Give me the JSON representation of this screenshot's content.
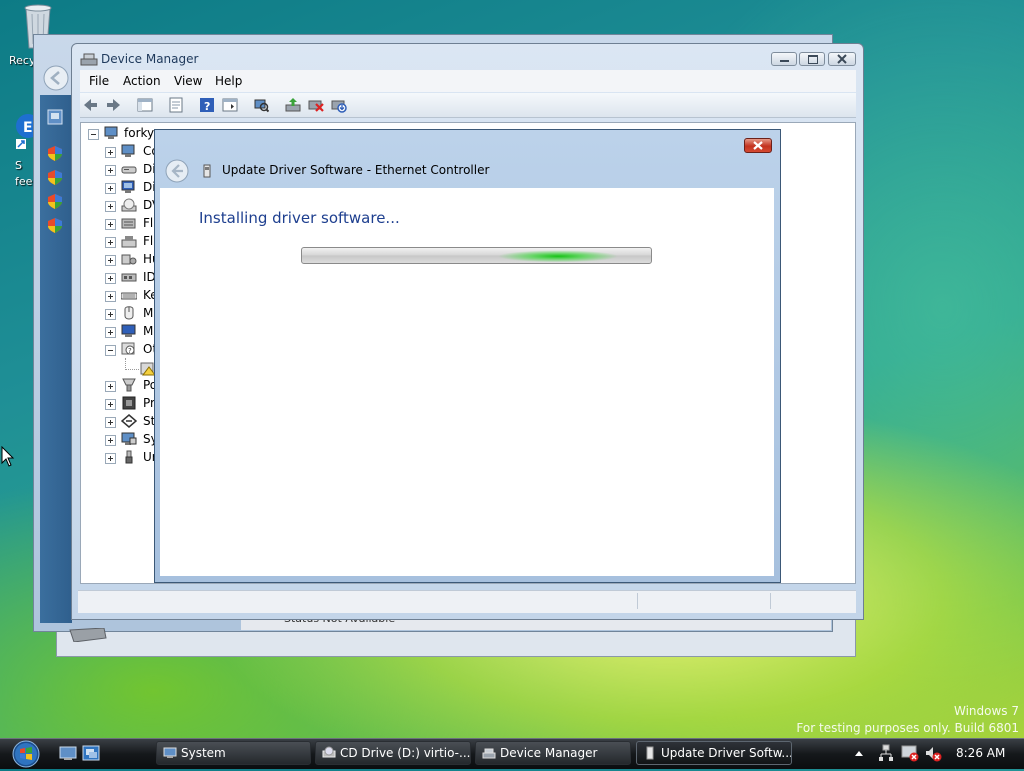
{
  "desktop": {
    "icons": [
      {
        "label": "Recy",
        "icon": "recycle-bin-icon"
      },
      {
        "label": "S\nfeed",
        "icon": "feedback-shortcut-icon"
      }
    ],
    "watermark": {
      "line1": "Windows 7",
      "line2": "For testing purposes only. Build 6801"
    }
  },
  "background_window": {
    "status_text": "Status Not Available"
  },
  "device_manager": {
    "title": "Device Manager",
    "menu": [
      "File",
      "Action",
      "View",
      "Help"
    ],
    "toolbar": [
      "back-icon",
      "forward-icon",
      "show-hide-tree-icon",
      "properties-icon",
      "help-icon",
      "view-icon",
      "scan-hardware-icon",
      "update-driver-icon",
      "uninstall-icon",
      "disable-icon"
    ],
    "tree": {
      "root": "forky-",
      "items": [
        {
          "label": "Co",
          "icon": "computer-icon",
          "expanded": false
        },
        {
          "label": "Di",
          "icon": "disk-drive-icon",
          "expanded": false
        },
        {
          "label": "Di",
          "icon": "display-adapter-icon",
          "expanded": false
        },
        {
          "label": "DV",
          "icon": "dvd-drive-icon",
          "expanded": false
        },
        {
          "label": "Fl",
          "icon": "floppy-controller-icon",
          "expanded": false
        },
        {
          "label": "Fl",
          "icon": "floppy-drive-icon",
          "expanded": false
        },
        {
          "label": "Hu",
          "icon": "hid-icon",
          "expanded": false
        },
        {
          "label": "ID",
          "icon": "ide-controller-icon",
          "expanded": false
        },
        {
          "label": "Ke",
          "icon": "keyboard-icon",
          "expanded": false
        },
        {
          "label": "M",
          "icon": "mouse-icon",
          "expanded": false
        },
        {
          "label": "M",
          "icon": "monitor-icon",
          "expanded": false
        },
        {
          "label": "Ot",
          "icon": "other-devices-icon",
          "expanded": true
        },
        {
          "label": "Po",
          "icon": "ports-icon",
          "expanded": false
        },
        {
          "label": "Pr",
          "icon": "processor-icon",
          "expanded": false
        },
        {
          "label": "St",
          "icon": "storage-controller-icon",
          "expanded": false
        },
        {
          "label": "Sy",
          "icon": "system-devices-icon",
          "expanded": false
        },
        {
          "label": "Ur",
          "icon": "usb-icon",
          "expanded": false
        }
      ]
    }
  },
  "update_dialog": {
    "title": "Update Driver Software - Ethernet Controller",
    "heading": "Installing driver software...",
    "progress": "indeterminate"
  },
  "taskbar": {
    "buttons": [
      {
        "label": "System",
        "icon": "system-icon",
        "active": false
      },
      {
        "label": "CD Drive (D:) virtio-...",
        "icon": "cd-drive-icon",
        "active": false
      },
      {
        "label": "Device Manager",
        "icon": "device-manager-icon",
        "active": false
      },
      {
        "label": "Update Driver Softw...",
        "icon": "update-driver-icon",
        "active": true
      }
    ],
    "clock": "8:26 AM"
  }
}
